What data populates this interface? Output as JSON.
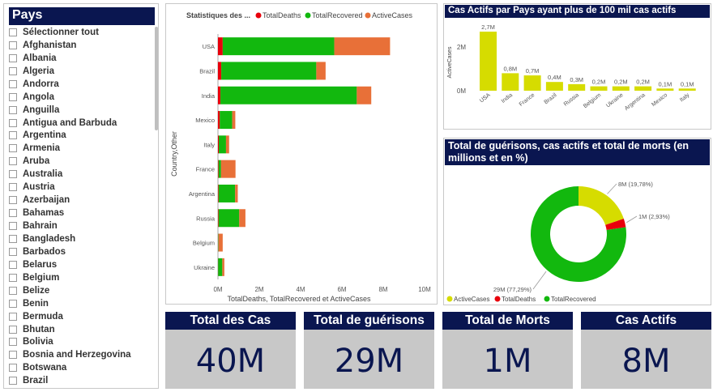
{
  "slicer": {
    "title": "Pays",
    "items": [
      "Sélectionner tout",
      "Afghanistan",
      "Albania",
      "Algeria",
      "Andorra",
      "Angola",
      "Anguilla",
      "Antigua and Barbuda",
      "Argentina",
      "Armenia",
      "Aruba",
      "Australia",
      "Austria",
      "Azerbaijan",
      "Bahamas",
      "Bahrain",
      "Bangladesh",
      "Barbados",
      "Belarus",
      "Belgium",
      "Belize",
      "Benin",
      "Bermuda",
      "Bhutan",
      "Bolivia",
      "Bosnia and Herzegovina",
      "Botswana",
      "Brazil"
    ]
  },
  "bar_chart": {
    "title": "Statistiques des ...",
    "legend": [
      "TotalDeaths",
      "TotalRecovered",
      "ActiveCases"
    ],
    "ylabel": "Country,Other",
    "xlabel": "TotalDeaths, TotalRecovered et ActiveCases"
  },
  "column_chart": {
    "title": "Cas Actifs par Pays ayant plus de 100 mil cas actifs",
    "ylabel": "ActiveCases"
  },
  "donut_chart": {
    "title_line1": "Total de guérisons, cas actifs et total de morts (en",
    "title_line2": "millions et en %)",
    "labels": [
      "8M (19,78%)",
      "1M (2,93%)",
      "29M (77,29%)"
    ],
    "legend": [
      "ActiveCases",
      "TotalDeaths",
      "TotalRecovered"
    ]
  },
  "kpis": [
    {
      "label": "Total des Cas",
      "value": "40M"
    },
    {
      "label": "Total de guérisons",
      "value": "29M"
    },
    {
      "label": "Total de Morts",
      "value": "1M"
    },
    {
      "label": "Cas Actifs",
      "value": "8M"
    }
  ],
  "colors": {
    "deaths": "#e8000b",
    "recovered": "#12b80e",
    "active": "#e87038",
    "active_col": "#d6dc00",
    "navy": "#0a1650"
  },
  "chart_data": [
    {
      "type": "bar",
      "orientation": "horizontal",
      "stacked": true,
      "categories": [
        "USA",
        "Brazil",
        "India",
        "Mexico",
        "Italy",
        "France",
        "Argentina",
        "Russia",
        "Belgium",
        "Ukraine"
      ],
      "series": [
        {
          "name": "TotalDeaths",
          "values": [
            0.23,
            0.16,
            0.12,
            0.09,
            0.04,
            0.03,
            0.03,
            0.03,
            0.01,
            0.01
          ]
        },
        {
          "name": "TotalRecovered",
          "values": [
            5.4,
            4.6,
            6.6,
            0.6,
            0.35,
            0.12,
            0.8,
            1.0,
            0.02,
            0.2
          ]
        },
        {
          "name": "ActiveCases",
          "values": [
            2.7,
            0.45,
            0.7,
            0.15,
            0.15,
            0.7,
            0.13,
            0.3,
            0.2,
            0.1
          ]
        }
      ],
      "xlim": [
        0,
        10
      ],
      "xticks": [
        "0M",
        "2M",
        "4M",
        "6M",
        "8M",
        "10M"
      ]
    },
    {
      "type": "bar",
      "categories": [
        "USA",
        "India",
        "France",
        "Brazil",
        "Russia",
        "Belgium",
        "Ukraine",
        "Argentina",
        "Mexico",
        "Italy"
      ],
      "values": [
        2.7,
        0.8,
        0.7,
        0.4,
        0.3,
        0.2,
        0.2,
        0.2,
        0.1,
        0.1
      ],
      "data_labels": [
        "2,7M",
        "0,8M",
        "0,7M",
        "0,4M",
        "0,3M",
        "0,2M",
        "0,2M",
        "0,2M",
        "0,1M",
        "0,1M"
      ],
      "ylim": [
        0,
        3
      ],
      "yticks": [
        "0M",
        "2M"
      ]
    },
    {
      "type": "pie",
      "donut": true,
      "categories": [
        "ActiveCases",
        "TotalDeaths",
        "TotalRecovered"
      ],
      "values": [
        19.78,
        2.93,
        77.29
      ]
    }
  ]
}
